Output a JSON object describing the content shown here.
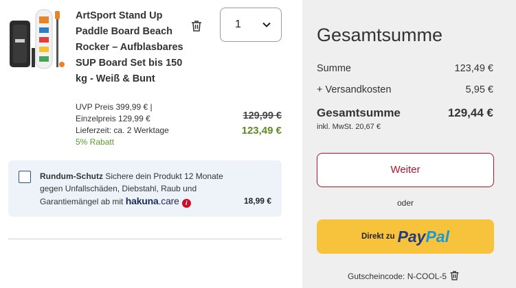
{
  "product": {
    "title": "ArtSport Stand Up Paddle Board Beach Rocker – Aufblasbares SUP Board Set bis 150 kg - Weiß & Bunt",
    "quantity": "1",
    "uvp_label": "UVP Preis",
    "uvp_value": "399,99 € |",
    "single_label": "Einzelpreis",
    "single_value": "129,99 €",
    "delivery_label": "Lieferzeit:",
    "delivery_value": "ca. 2 Werktage",
    "discount": "5% Rabatt",
    "old_price": "129,99 €",
    "new_price": "123,49 €",
    "icons": [
      "trash-icon",
      "chevron-down-icon"
    ]
  },
  "protection": {
    "bold": "Rundum-Schutz",
    "text": "Sichere dein Produkt 12 Monate gegen Unfallschäden, Diebstahl, Raub und Garantiemängel ab mit",
    "brand_main": "hakuna",
    "brand_suffix": ".care",
    "info_glyph": "i",
    "price": "18,99 €"
  },
  "summary": {
    "title": "Gesamtsumme",
    "subtotal_label": "Summe",
    "subtotal_value": "123,49 €",
    "shipping_label": "+ Versandkosten",
    "shipping_value": "5,95 €",
    "total_label": "Gesamtsumme",
    "total_value": "129,44 €",
    "vat": "inkl. MwSt. 20,67 €",
    "continue_label": "Weiter",
    "or_label": "oder",
    "paypal_prefix": "Direkt zu",
    "paypal_pay": "Pay",
    "paypal_pal": "Pal",
    "coupon": "Gutscheincode: N-COOL-5"
  },
  "colors": {
    "accent_red": "#b3132b",
    "price_green": "#5c8a24",
    "paypal_yellow": "#f7c33c",
    "summary_bg": "#efefef",
    "protect_bg": "#eef3f9"
  }
}
